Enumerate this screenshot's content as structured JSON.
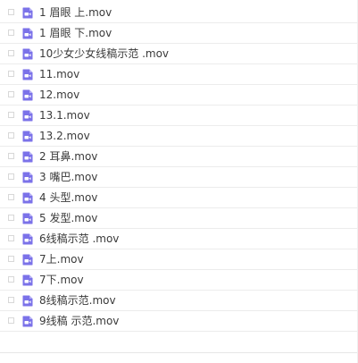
{
  "colors": {
    "icon_purple": "#7b72e9",
    "icon_play": "#ffffff",
    "text": "#3a3a3a",
    "row_border": "#ececec"
  },
  "file_icon": "video-file-icon",
  "files": [
    {
      "name": "1 眉眼 上.mov"
    },
    {
      "name": "1 眉眼 下.mov"
    },
    {
      "name": "10少女少女线稿示范 .mov"
    },
    {
      "name": "11.mov"
    },
    {
      "name": "12.mov"
    },
    {
      "name": "13.1.mov"
    },
    {
      "name": "13.2.mov"
    },
    {
      "name": "2 耳鼻.mov"
    },
    {
      "name": "3 嘴巴.mov"
    },
    {
      "name": "4 头型.mov"
    },
    {
      "name": "5 发型.mov"
    },
    {
      "name": "6线稿示范 .mov"
    },
    {
      "name": "7上.mov"
    },
    {
      "name": "7下.mov"
    },
    {
      "name": "8线稿示范.mov"
    },
    {
      "name": "9线稿 示范.mov"
    }
  ]
}
